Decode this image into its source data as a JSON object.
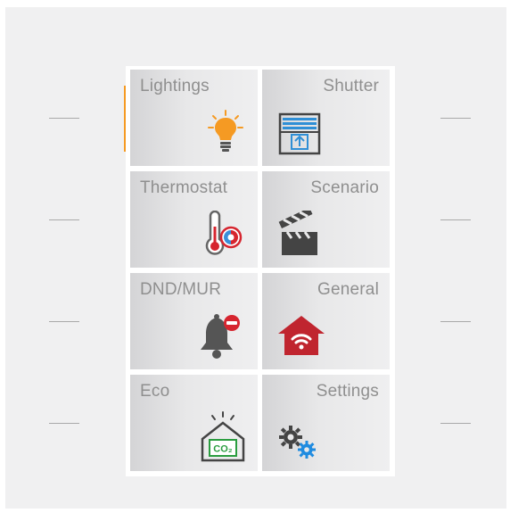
{
  "tiles": [
    {
      "label": "Lightings",
      "icon": "lightbulb-icon"
    },
    {
      "label": "Shutter",
      "icon": "shutter-icon"
    },
    {
      "label": "Thermostat",
      "icon": "thermometer-icon"
    },
    {
      "label": "Scenario",
      "icon": "clapperboard-icon"
    },
    {
      "label": "DND/MUR",
      "icon": "bell-icon"
    },
    {
      "label": "General",
      "icon": "home-wifi-icon"
    },
    {
      "label": "Eco",
      "icon": "co2-house-icon"
    },
    {
      "label": "Settings",
      "icon": "gears-icon"
    }
  ],
  "indicators": {
    "left_color": "#f59a23",
    "right_color": "#1470c2"
  },
  "co2_text": "CO₂"
}
